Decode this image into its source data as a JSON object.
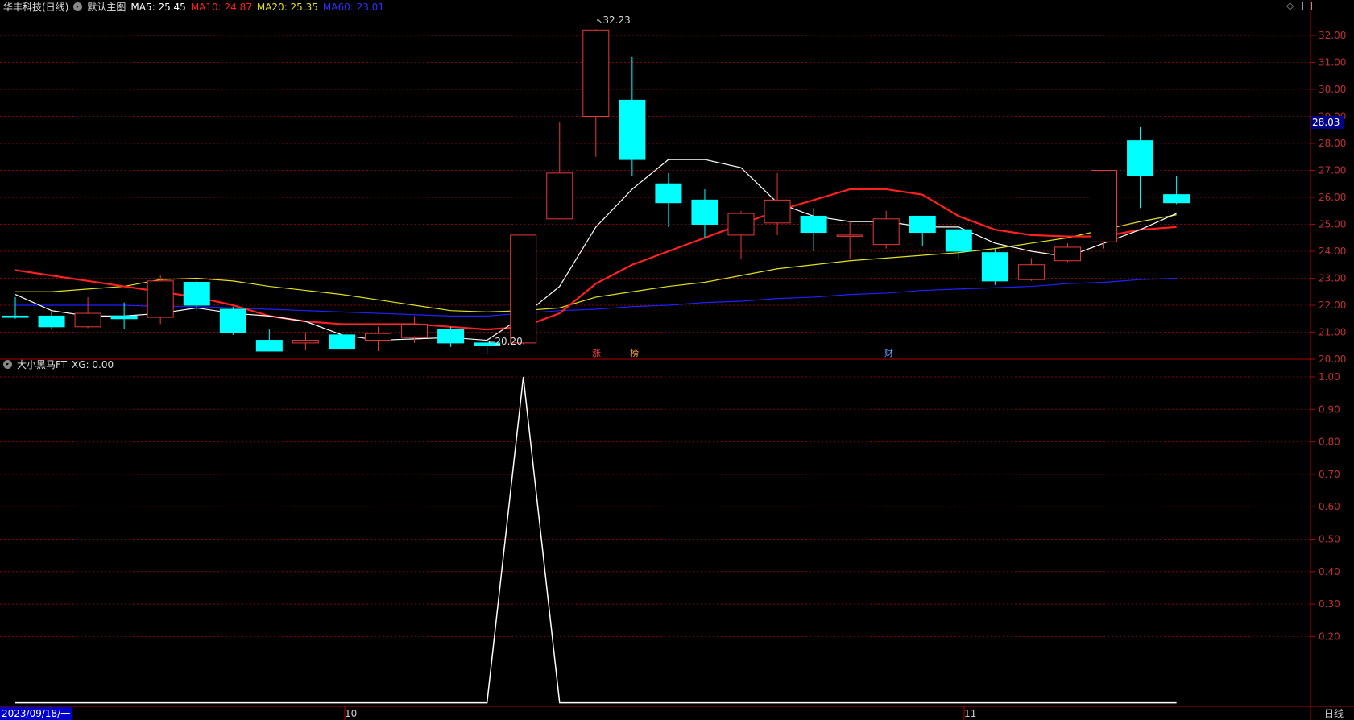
{
  "header": {
    "stock_name": "华丰科技(日线)",
    "main_chart_label": "默认主图",
    "ma5": "MA5: 25.45",
    "ma10": "MA10: 24.87",
    "ma20": "MA20: 25.35",
    "ma60": "MA60: 23.01"
  },
  "indicator": {
    "name": "大小黑马FT",
    "xg": "XG: 0.00"
  },
  "price_axis": {
    "ticks": [
      "32.00",
      "31.00",
      "30.00",
      "29.00",
      "28.00",
      "27.00",
      "26.00",
      "25.00",
      "24.00",
      "23.00",
      "22.00",
      "21.00",
      "20.00"
    ],
    "current_price": "28.03"
  },
  "ind_axis": {
    "ticks": [
      "1.00",
      "0.90",
      "0.80",
      "0.70",
      "0.60",
      "0.50",
      "0.40",
      "0.30",
      "0.20"
    ]
  },
  "annotations": {
    "high": "32.23",
    "low": "20.20",
    "tag_zhang": "涨",
    "tag_bang": "榜",
    "tag_cai": "财"
  },
  "date_axis": {
    "start": "2023/09/18/一",
    "oct": "10",
    "nov": "11",
    "period": "日线"
  },
  "colors": {
    "up": "#e8393a",
    "down": "#00ffff",
    "ma5": "#ffffff",
    "ma10": "#ff2020",
    "ma20": "#e0e020",
    "ma60": "#2020ff",
    "grid": "#8b0000",
    "axis": "#b00000"
  },
  "chart_data": {
    "type": "candlestick",
    "price_range": [
      20.0,
      32.0
    ],
    "candles": [
      {
        "o": 21.6,
        "c": 21.55,
        "h": 22.3,
        "l": 21.5
      },
      {
        "o": 21.6,
        "c": 21.2,
        "h": 21.8,
        "l": 21.1
      },
      {
        "o": 21.2,
        "c": 21.7,
        "h": 22.3,
        "l": 21.15
      },
      {
        "o": 21.6,
        "c": 21.5,
        "h": 22.1,
        "l": 21.1
      },
      {
        "o": 21.55,
        "c": 22.9,
        "h": 23.1,
        "l": 21.3
      },
      {
        "o": 22.85,
        "c": 22.0,
        "h": 22.9,
        "l": 21.8
      },
      {
        "o": 21.85,
        "c": 21.0,
        "h": 21.95,
        "l": 20.9
      },
      {
        "o": 20.7,
        "c": 20.3,
        "h": 21.1,
        "l": 20.3
      },
      {
        "o": 20.6,
        "c": 20.7,
        "h": 21.0,
        "l": 20.35
      },
      {
        "o": 20.9,
        "c": 20.4,
        "h": 20.9,
        "l": 20.3
      },
      {
        "o": 20.7,
        "c": 20.95,
        "h": 21.2,
        "l": 20.3
      },
      {
        "o": 20.8,
        "c": 21.3,
        "h": 21.6,
        "l": 20.6
      },
      {
        "o": 21.1,
        "c": 20.6,
        "h": 21.2,
        "l": 20.45
      },
      {
        "o": 20.6,
        "c": 20.5,
        "h": 20.8,
        "l": 20.2
      },
      {
        "o": 20.6,
        "c": 24.6,
        "h": 24.6,
        "l": 20.55
      },
      {
        "o": 25.2,
        "c": 26.9,
        "h": 28.8,
        "l": 25.2
      },
      {
        "o": 29.0,
        "c": 32.2,
        "h": 32.23,
        "l": 27.5
      },
      {
        "o": 29.6,
        "c": 27.4,
        "h": 31.2,
        "l": 26.8
      },
      {
        "o": 26.5,
        "c": 25.8,
        "h": 26.9,
        "l": 24.9
      },
      {
        "o": 25.9,
        "c": 25.0,
        "h": 26.3,
        "l": 24.5
      },
      {
        "o": 24.6,
        "c": 25.4,
        "h": 25.5,
        "l": 23.7
      },
      {
        "o": 25.05,
        "c": 25.9,
        "h": 26.9,
        "l": 24.6
      },
      {
        "o": 25.3,
        "c": 24.7,
        "h": 25.6,
        "l": 24.0
      },
      {
        "o": 24.6,
        "c": 24.6,
        "h": 25.1,
        "l": 23.7
      },
      {
        "o": 24.25,
        "c": 25.2,
        "h": 25.5,
        "l": 24.1
      },
      {
        "o": 25.3,
        "c": 24.7,
        "h": 25.3,
        "l": 24.2
      },
      {
        "o": 24.8,
        "c": 24.0,
        "h": 24.9,
        "l": 23.7
      },
      {
        "o": 23.95,
        "c": 22.9,
        "h": 24.1,
        "l": 22.75
      },
      {
        "o": 22.95,
        "c": 23.5,
        "h": 23.75,
        "l": 22.9
      },
      {
        "o": 23.65,
        "c": 24.15,
        "h": 24.3,
        "l": 23.6
      },
      {
        "o": 24.35,
        "c": 27.0,
        "h": 27.0,
        "l": 24.1
      },
      {
        "o": 28.1,
        "c": 26.8,
        "h": 28.6,
        "l": 25.6
      },
      {
        "o": 26.1,
        "c": 25.8,
        "h": 26.8,
        "l": 25.75
      }
    ],
    "series": [
      {
        "name": "MA5",
        "values": [
          22.4,
          21.8,
          21.6,
          21.6,
          21.7,
          21.9,
          21.7,
          21.6,
          21.4,
          20.9,
          20.7,
          20.75,
          20.8,
          20.7,
          21.6,
          22.7,
          24.9,
          26.3,
          27.4,
          27.4,
          27.1,
          25.8,
          25.3,
          25.1,
          25.1,
          24.9,
          24.9,
          24.3,
          24.0,
          23.8,
          24.3,
          24.8,
          25.4
        ]
      },
      {
        "name": "MA10",
        "values": [
          23.3,
          23.1,
          22.9,
          22.7,
          22.5,
          22.3,
          22.0,
          21.6,
          21.4,
          21.3,
          21.3,
          21.3,
          21.2,
          21.1,
          21.2,
          21.7,
          22.8,
          23.5,
          24.0,
          24.5,
          25.0,
          25.5,
          25.9,
          26.3,
          26.3,
          26.1,
          25.3,
          24.8,
          24.6,
          24.55,
          24.55,
          24.8,
          24.9
        ]
      },
      {
        "name": "MA20",
        "values": [
          22.5,
          22.5,
          22.6,
          22.7,
          22.95,
          23.0,
          22.9,
          22.7,
          22.55,
          22.4,
          22.2,
          22.0,
          21.8,
          21.75,
          21.8,
          21.9,
          22.3,
          22.5,
          22.7,
          22.85,
          23.1,
          23.35,
          23.5,
          23.65,
          23.75,
          23.85,
          23.95,
          24.1,
          24.3,
          24.5,
          24.8,
          25.1,
          25.35
        ]
      },
      {
        "name": "MA60",
        "values": [
          22.0,
          22.0,
          22.0,
          22.0,
          21.95,
          21.95,
          21.9,
          21.85,
          21.8,
          21.75,
          21.7,
          21.65,
          21.6,
          21.6,
          21.7,
          21.8,
          21.85,
          21.95,
          22.0,
          22.1,
          22.15,
          22.25,
          22.3,
          22.4,
          22.45,
          22.55,
          22.6,
          22.65,
          22.7,
          22.8,
          22.85,
          22.95,
          23.0
        ]
      }
    ],
    "indicator": {
      "name": "大小黑马FT",
      "range": [
        0.1,
        1.05
      ],
      "values": [
        0,
        0,
        0,
        0,
        0,
        0,
        0,
        0,
        0,
        0,
        0,
        0,
        0,
        0,
        1,
        0,
        0,
        0,
        0,
        0,
        0,
        0,
        0,
        0,
        0,
        0,
        0,
        0,
        0,
        0,
        0,
        0,
        0
      ]
    }
  }
}
